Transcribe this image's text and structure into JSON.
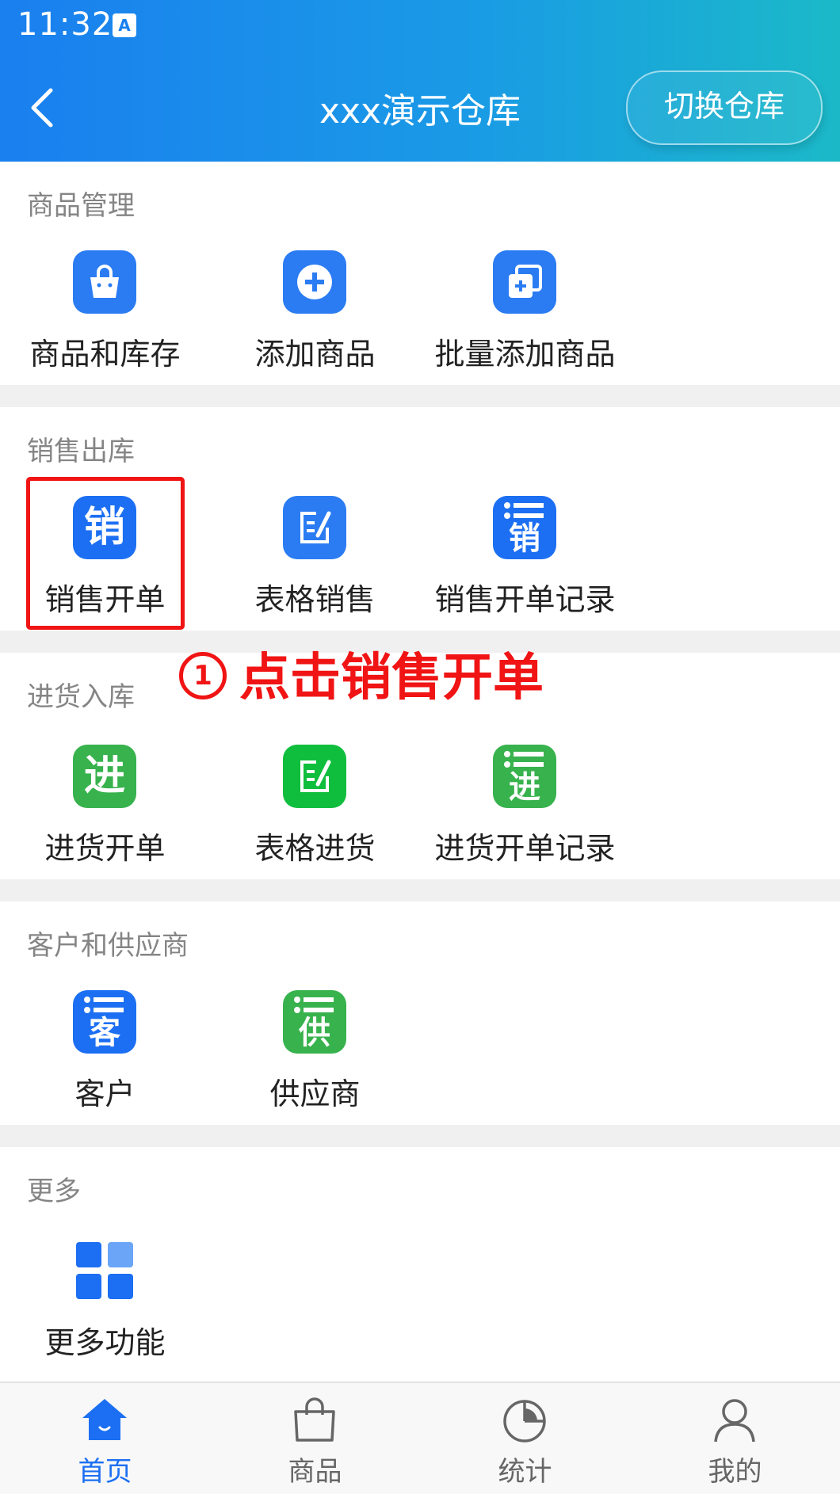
{
  "status_bar": {
    "time": "11:32",
    "badge": "A"
  },
  "header": {
    "title": "xxx演示仓库",
    "switch_label": "切换仓库"
  },
  "sections": [
    {
      "title": "商品管理",
      "items": [
        {
          "label": "商品和库存",
          "icon": "shopping-bag-icon"
        },
        {
          "label": "添加商品",
          "icon": "plus-circle-icon"
        },
        {
          "label": "批量添加商品",
          "icon": "batch-add-icon"
        }
      ]
    },
    {
      "title": "销售出库",
      "items": [
        {
          "label": "销售开单",
          "icon": "sales-icon",
          "glyph": "销"
        },
        {
          "label": "表格销售",
          "icon": "table-edit-icon"
        },
        {
          "label": "销售开单记录",
          "icon": "sales-record-icon",
          "glyph": "销"
        }
      ]
    },
    {
      "title": "进货入库",
      "items": [
        {
          "label": "进货开单",
          "icon": "purchase-icon",
          "glyph": "进"
        },
        {
          "label": "表格进货",
          "icon": "table-edit-icon"
        },
        {
          "label": "进货开单记录",
          "icon": "purchase-record-icon",
          "glyph": "进"
        }
      ]
    },
    {
      "title": "客户和供应商",
      "items": [
        {
          "label": "客户",
          "icon": "customer-icon",
          "glyph": "客"
        },
        {
          "label": "供应商",
          "icon": "supplier-icon",
          "glyph": "供"
        }
      ]
    },
    {
      "title": "更多",
      "items": [
        {
          "label": "更多功能",
          "icon": "grid-icon"
        }
      ]
    }
  ],
  "annotation": {
    "number": "1",
    "text": "点击销售开单"
  },
  "tabbar": [
    {
      "label": "首页",
      "icon": "home-icon",
      "active": true
    },
    {
      "label": "商品",
      "icon": "bag-icon",
      "active": false
    },
    {
      "label": "统计",
      "icon": "pie-chart-icon",
      "active": false
    },
    {
      "label": "我的",
      "icon": "user-icon",
      "active": false
    }
  ],
  "colors": {
    "accent": "#1c6ff2",
    "green": "#37b24d",
    "highlight": "#f01414",
    "header_start": "#1a7fef",
    "header_end": "#1bb9c8"
  }
}
